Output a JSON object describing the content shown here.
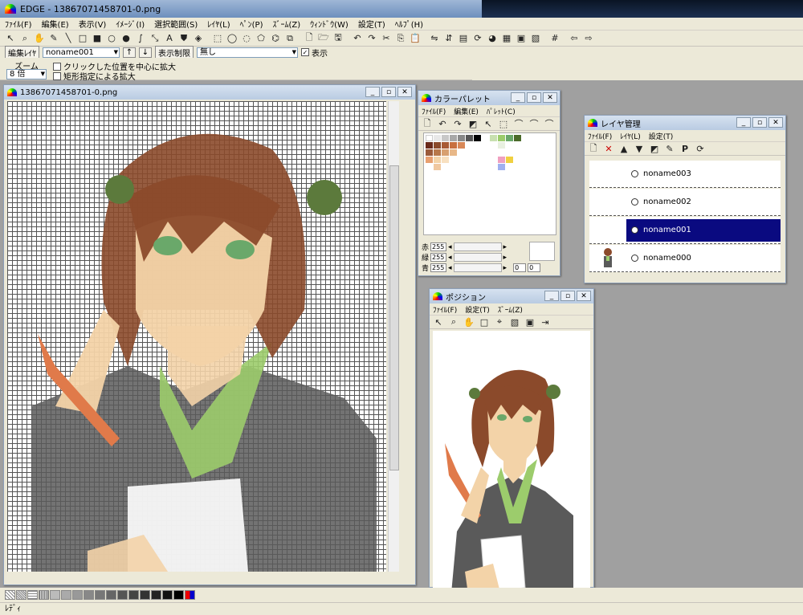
{
  "app": {
    "title": "EDGE - 13867071458701-0.png"
  },
  "menu": [
    "ﾌｧｲﾙ(F)",
    "編集(E)",
    "表示(V)",
    "ｲﾒｰｼﾞ(I)",
    "選択範囲(S)",
    "ﾚｲﾔ(L)",
    "ﾍﾟﾝ(P)",
    "ｽﾞｰﾑ(Z)",
    "ｳｨﾝﾄﾞｳ(W)",
    "設定(T)",
    "ﾍﾙﾌﾟ(H)"
  ],
  "options": {
    "edit_layer_label": "編集ﾚｲﾔ",
    "edit_layer_value": "noname001",
    "display_limit_label": "表示制限",
    "display_limit_value": "無し",
    "display_label": "表示",
    "zoom_label": "ズーム",
    "zoom_value": "8 倍",
    "click_center_zoom": "クリックした位置を中心に拡大",
    "rect_zoom": "矩形指定による拡大"
  },
  "canvas_window": {
    "title": "13867071458701-0.png"
  },
  "palette_window": {
    "title": "カラーパレット",
    "menu": [
      "ﾌｧｲﾙ(F)",
      "編集(E)",
      "ﾊﾟﾚｯﾄ(C)"
    ],
    "rgb": [
      {
        "label": "赤",
        "value": "255"
      },
      {
        "label": "緑",
        "value": "255"
      },
      {
        "label": "青",
        "value": "255"
      }
    ],
    "extra_values": [
      "0",
      "0"
    ]
  },
  "layer_window": {
    "title": "レイヤ管理",
    "menu": [
      "ﾌｧｲﾙ(F)",
      "ﾚｲﾔ(L)",
      "設定(T)"
    ],
    "layers": [
      {
        "name": "noname003"
      },
      {
        "name": "noname002"
      },
      {
        "name": "noname001"
      },
      {
        "name": "noname000"
      }
    ]
  },
  "position_window": {
    "title": "ポジション",
    "menu": [
      "ﾌｧｲﾙ(F)",
      "設定(T)",
      "ｽﾞｰﾑ(Z)"
    ]
  },
  "status": {
    "text": "ﾚﾃﾞｨ"
  },
  "colors": {
    "selection": "#0a0a80",
    "hair": "#8b4a2b",
    "skin": "#f3d3a8",
    "suit": "#5a5a5a",
    "shirt": "#9ccc6c"
  }
}
